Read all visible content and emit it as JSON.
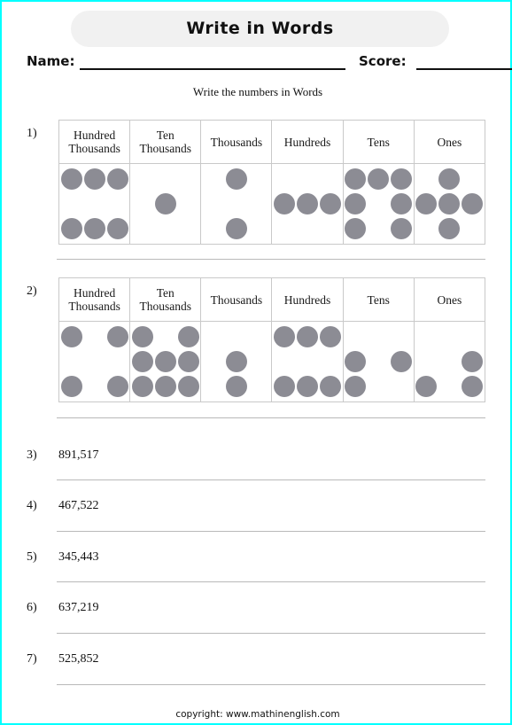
{
  "header": {
    "title": "Write in Words",
    "name_label": "Name:",
    "score_label": "Score:",
    "instruction": "Write the numbers in Words"
  },
  "place_value_columns": [
    "Hundred Thousands",
    "Ten Thousands",
    "Thousands",
    "Hundreds",
    "Tens",
    "Ones"
  ],
  "place_value_questions": [
    {
      "index": "1)",
      "counts": [
        6,
        1,
        2,
        3,
        7,
        5
      ],
      "number": "612,375",
      "dot_rows": [
        [
          [
            1,
            1,
            1
          ],
          [
            0,
            0,
            0
          ],
          [
            1,
            1,
            1
          ]
        ],
        [
          [
            0,
            0,
            0
          ],
          [
            0,
            1,
            0
          ],
          [
            0,
            0,
            0
          ]
        ],
        [
          [
            0,
            1,
            0
          ],
          [
            0,
            0,
            0
          ],
          [
            0,
            1,
            0
          ]
        ],
        [
          [
            0,
            0,
            0
          ],
          [
            1,
            1,
            1
          ],
          [
            0,
            0,
            0
          ]
        ],
        [
          [
            1,
            1,
            1
          ],
          [
            1,
            0,
            1
          ],
          [
            1,
            0,
            1
          ]
        ],
        [
          [
            0,
            1,
            0
          ],
          [
            1,
            1,
            1
          ],
          [
            0,
            1,
            0
          ]
        ]
      ]
    },
    {
      "index": "2)",
      "counts": [
        4,
        8,
        2,
        6,
        3,
        3
      ],
      "number": "482,633",
      "dot_rows": [
        [
          [
            1,
            0,
            1
          ],
          [
            0,
            0,
            0
          ],
          [
            1,
            0,
            1
          ]
        ],
        [
          [
            1,
            0,
            1
          ],
          [
            1,
            1,
            1
          ],
          [
            1,
            1,
            1
          ]
        ],
        [
          [
            0,
            0,
            0
          ],
          [
            0,
            1,
            0
          ],
          [
            0,
            1,
            0
          ]
        ],
        [
          [
            1,
            1,
            1
          ],
          [
            0,
            0,
            0
          ],
          [
            1,
            1,
            1
          ]
        ],
        [
          [
            0,
            0,
            0
          ],
          [
            1,
            0,
            1
          ],
          [
            1,
            0,
            0
          ]
        ],
        [
          [
            0,
            0,
            0
          ],
          [
            0,
            0,
            1
          ],
          [
            1,
            0,
            1
          ]
        ]
      ]
    }
  ],
  "number_questions": [
    {
      "index": "3)",
      "value": "891,517"
    },
    {
      "index": "4)",
      "value": "467,522"
    },
    {
      "index": "5)",
      "value": "345,443"
    },
    {
      "index": "6)",
      "value": "637,219"
    },
    {
      "index": "7)",
      "value": "525,852"
    }
  ],
  "footer": {
    "text": "copyright:   www.mathinenglish.com"
  },
  "colors": {
    "page_border": "#00ffff",
    "title_bg": "#f1f1f1",
    "dot": "#8c8c94",
    "table_border": "#c9c9c9",
    "answer_line": "#b9b9b9"
  }
}
